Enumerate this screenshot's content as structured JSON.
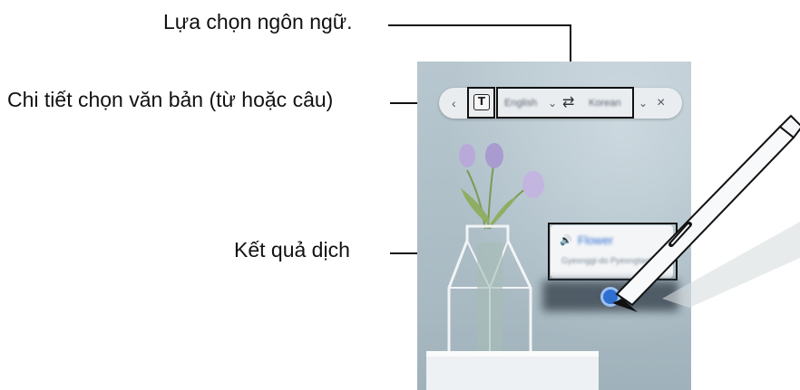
{
  "callouts": {
    "language": "Lựa chọn ngôn ngữ.",
    "text_mode": "Chi tiết chọn văn bản (từ hoặc câu)",
    "result": "Kết quả dịch"
  },
  "toolbar": {
    "back_symbol": "‹",
    "mode_icon_glyph": "T",
    "source_language": "English",
    "swap_symbol": "⇄",
    "target_language": "Korean",
    "dropdown_symbol": "⌄",
    "more_symbol": "⌄",
    "close_symbol": "×"
  },
  "result_card": {
    "speaker_glyph": "🔊",
    "translation": "Flower",
    "pronunciation": "Gyeonggi-do Pyeongtaek"
  },
  "icons": [
    "text-mode-icon",
    "swap-icon",
    "chevron-down-icon",
    "close-icon",
    "speaker-icon",
    "s-pen-icon"
  ],
  "colors": {
    "wall": "#aebfc8",
    "toolbar": "#e9edf0",
    "selector_accent": "#2f6fd0"
  }
}
